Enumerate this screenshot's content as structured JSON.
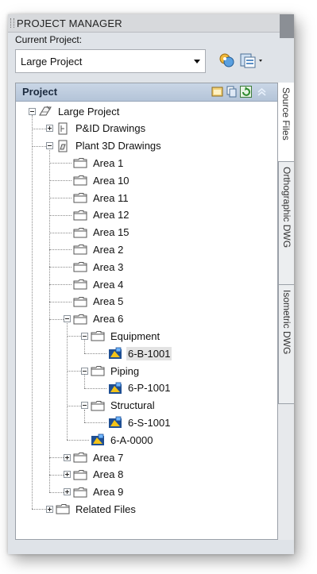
{
  "window": {
    "title": "PROJECT MANAGER",
    "current_project_label": "Current Project:",
    "current_project_value": "Large Project"
  },
  "panel": {
    "header_label": "Project",
    "side_tabs": [
      "Source Files",
      "Orthographic DWG",
      "Isometric DWG"
    ]
  },
  "tree": [
    {
      "label": "Large Project",
      "level": 0,
      "expander": "minus",
      "icon": "project-icon"
    },
    {
      "label": "P&ID Drawings",
      "level": 1,
      "expander": "plus",
      "icon": "pid-drawings-icon"
    },
    {
      "label": "Plant 3D Drawings",
      "level": 1,
      "expander": "minus",
      "icon": "plant3d-drawings-icon"
    },
    {
      "label": "Area 1",
      "level": 2,
      "expander": null,
      "icon": "folder-icon"
    },
    {
      "label": "Area 10",
      "level": 2,
      "expander": null,
      "icon": "folder-icon"
    },
    {
      "label": "Area 11",
      "level": 2,
      "expander": null,
      "icon": "folder-icon"
    },
    {
      "label": "Area 12",
      "level": 2,
      "expander": null,
      "icon": "folder-icon"
    },
    {
      "label": "Area 15",
      "level": 2,
      "expander": null,
      "icon": "folder-icon"
    },
    {
      "label": "Area 2",
      "level": 2,
      "expander": null,
      "icon": "folder-icon"
    },
    {
      "label": "Area 3",
      "level": 2,
      "expander": null,
      "icon": "folder-icon"
    },
    {
      "label": "Area 4",
      "level": 2,
      "expander": null,
      "icon": "folder-icon"
    },
    {
      "label": "Area 5",
      "level": 2,
      "expander": null,
      "icon": "folder-icon"
    },
    {
      "label": "Area 6",
      "level": 2,
      "expander": "minus",
      "icon": "folder-icon"
    },
    {
      "label": "Equipment",
      "level": 3,
      "expander": "minus",
      "icon": "folder-icon"
    },
    {
      "label": "6-B-1001",
      "level": 4,
      "expander": null,
      "icon": "drawing-file-icon",
      "selected": true
    },
    {
      "label": "Piping",
      "level": 3,
      "expander": "minus",
      "icon": "folder-icon"
    },
    {
      "label": "6-P-1001",
      "level": 4,
      "expander": null,
      "icon": "drawing-file-icon"
    },
    {
      "label": "Structural",
      "level": 3,
      "expander": "minus",
      "icon": "folder-icon"
    },
    {
      "label": "6-S-1001",
      "level": 4,
      "expander": null,
      "icon": "drawing-file-icon"
    },
    {
      "label": "6-A-0000",
      "level": 3,
      "expander": null,
      "icon": "drawing-file-icon"
    },
    {
      "label": "Area 7",
      "level": 2,
      "expander": "plus",
      "icon": "folder-icon"
    },
    {
      "label": "Area 8",
      "level": 2,
      "expander": "plus",
      "icon": "folder-icon"
    },
    {
      "label": "Area 9",
      "level": 2,
      "expander": "plus",
      "icon": "folder-icon"
    },
    {
      "label": "Related Files",
      "level": 1,
      "expander": "plus",
      "icon": "folder-icon"
    }
  ]
}
